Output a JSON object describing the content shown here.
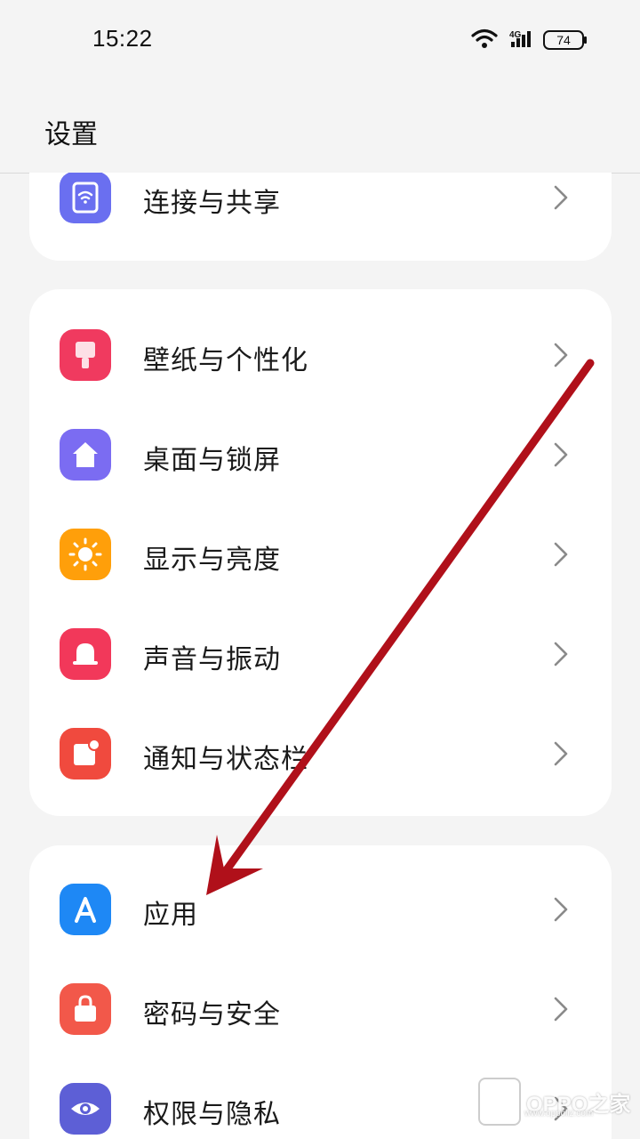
{
  "status_bar": {
    "time": "15:22",
    "network": "4G",
    "battery": "74"
  },
  "header": {
    "title": "设置"
  },
  "groups": [
    {
      "items": [
        {
          "label": "连接与共享",
          "icon": "connection-share-icon",
          "color": "#6a6ff0"
        }
      ]
    },
    {
      "items": [
        {
          "label": "壁纸与个性化",
          "icon": "wallpaper-brush-icon",
          "color": "#f03a5f"
        },
        {
          "label": "桌面与锁屏",
          "icon": "home-icon",
          "color": "#7b6cf2"
        },
        {
          "label": "显示与亮度",
          "icon": "sun-icon",
          "color": "#ff9f0a"
        },
        {
          "label": "声音与振动",
          "icon": "bell-icon",
          "color": "#f2385a"
        },
        {
          "label": "通知与状态栏",
          "icon": "notification-icon",
          "color": "#f04a3e"
        }
      ]
    },
    {
      "items": [
        {
          "label": "应用",
          "icon": "apps-a-icon",
          "color": "#1e88f5"
        },
        {
          "label": "密码与安全",
          "icon": "lock-bag-icon",
          "color": "#f2584a"
        },
        {
          "label": "权限与隐私",
          "icon": "eye-icon",
          "color": "#5d5fd6"
        }
      ]
    }
  ],
  "watermark": {
    "text": "OPPO之家",
    "sub": "www.oppoliz.com"
  },
  "annotation": {
    "color": "#b0101a"
  }
}
